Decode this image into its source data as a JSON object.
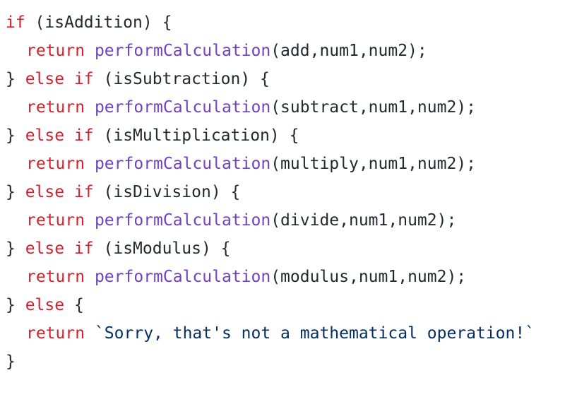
{
  "colors": {
    "keyword": "#cf222e",
    "function": "#6f42c1",
    "string": "#032f62",
    "text": "#24292e",
    "background": "#ffffff"
  },
  "code": {
    "lines": [
      {
        "indent": 0,
        "tokens": [
          {
            "t": "if",
            "k": "kw"
          },
          {
            "t": " (isAddition) {",
            "k": "plain"
          }
        ]
      },
      {
        "indent": 1,
        "tokens": [
          {
            "t": "return",
            "k": "kw"
          },
          {
            "t": " ",
            "k": "plain"
          },
          {
            "t": "performCalculation",
            "k": "fn"
          },
          {
            "t": "(add,num1,num2);",
            "k": "plain"
          }
        ]
      },
      {
        "indent": 0,
        "tokens": [
          {
            "t": "} ",
            "k": "plain"
          },
          {
            "t": "else",
            "k": "kw"
          },
          {
            "t": " ",
            "k": "plain"
          },
          {
            "t": "if",
            "k": "kw"
          },
          {
            "t": " (isSubtraction) {",
            "k": "plain"
          }
        ]
      },
      {
        "indent": 1,
        "tokens": [
          {
            "t": "return",
            "k": "kw"
          },
          {
            "t": " ",
            "k": "plain"
          },
          {
            "t": "performCalculation",
            "k": "fn"
          },
          {
            "t": "(subtract,num1,num2);",
            "k": "plain"
          }
        ]
      },
      {
        "indent": 0,
        "tokens": [
          {
            "t": "} ",
            "k": "plain"
          },
          {
            "t": "else",
            "k": "kw"
          },
          {
            "t": " ",
            "k": "plain"
          },
          {
            "t": "if",
            "k": "kw"
          },
          {
            "t": " (isMultiplication) {",
            "k": "plain"
          }
        ]
      },
      {
        "indent": 1,
        "tokens": [
          {
            "t": "return",
            "k": "kw"
          },
          {
            "t": " ",
            "k": "plain"
          },
          {
            "t": "performCalculation",
            "k": "fn"
          },
          {
            "t": "(multiply,num1,num2);",
            "k": "plain"
          }
        ]
      },
      {
        "indent": 0,
        "tokens": [
          {
            "t": "} ",
            "k": "plain"
          },
          {
            "t": "else",
            "k": "kw"
          },
          {
            "t": " ",
            "k": "plain"
          },
          {
            "t": "if",
            "k": "kw"
          },
          {
            "t": " (isDivision) {",
            "k": "plain"
          }
        ]
      },
      {
        "indent": 1,
        "tokens": [
          {
            "t": "return",
            "k": "kw"
          },
          {
            "t": " ",
            "k": "plain"
          },
          {
            "t": "performCalculation",
            "k": "fn"
          },
          {
            "t": "(divide,num1,num2);",
            "k": "plain"
          }
        ]
      },
      {
        "indent": 0,
        "tokens": [
          {
            "t": "} ",
            "k": "plain"
          },
          {
            "t": "else",
            "k": "kw"
          },
          {
            "t": " ",
            "k": "plain"
          },
          {
            "t": "if",
            "k": "kw"
          },
          {
            "t": " (isModulus) {",
            "k": "plain"
          }
        ]
      },
      {
        "indent": 1,
        "tokens": [
          {
            "t": "return",
            "k": "kw"
          },
          {
            "t": " ",
            "k": "plain"
          },
          {
            "t": "performCalculation",
            "k": "fn"
          },
          {
            "t": "(modulus,num1,num2);",
            "k": "plain"
          }
        ]
      },
      {
        "indent": 0,
        "tokens": [
          {
            "t": "} ",
            "k": "plain"
          },
          {
            "t": "else",
            "k": "kw"
          },
          {
            "t": " {",
            "k": "plain"
          }
        ]
      },
      {
        "indent": 1,
        "tokens": [
          {
            "t": "return",
            "k": "kw"
          },
          {
            "t": " ",
            "k": "plain"
          },
          {
            "t": "`Sorry, that's not a mathematical operation!`",
            "k": "str"
          }
        ]
      },
      {
        "indent": 0,
        "tokens": [
          {
            "t": "}",
            "k": "plain"
          }
        ]
      }
    ]
  }
}
